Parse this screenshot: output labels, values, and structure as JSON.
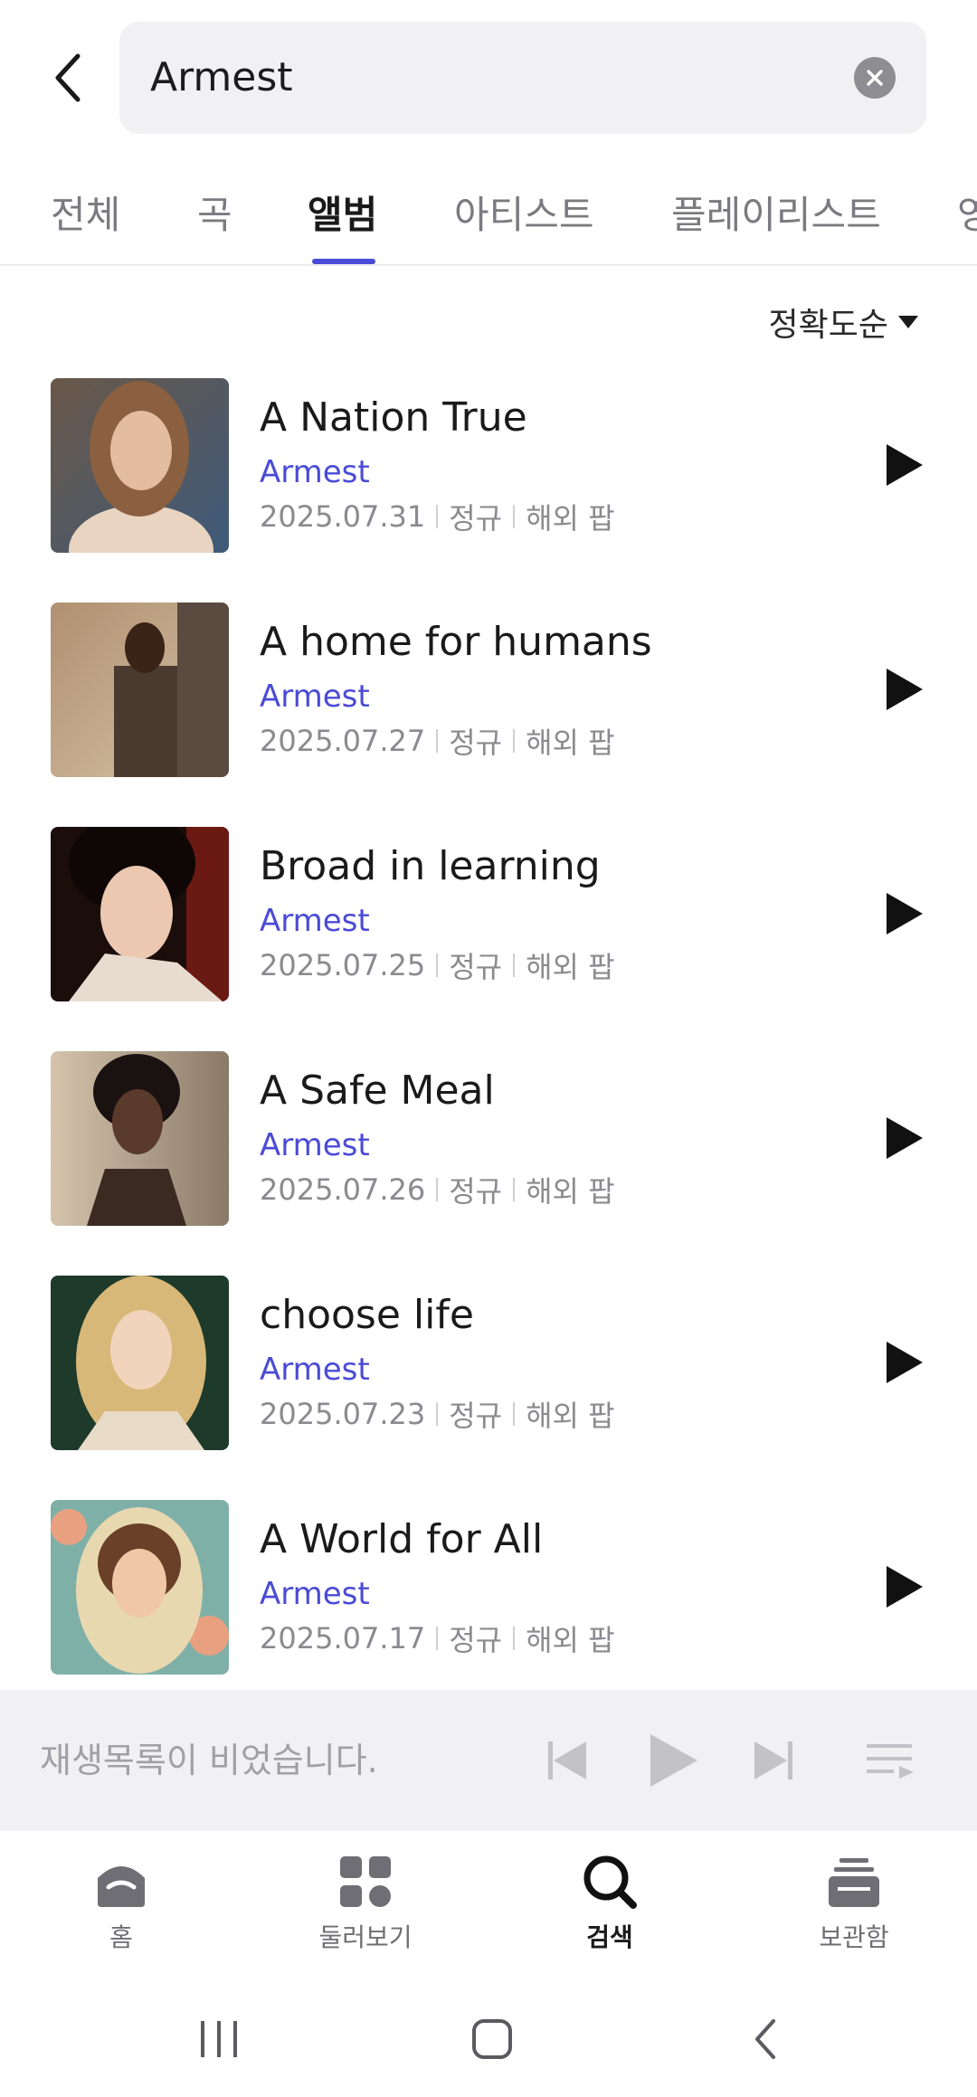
{
  "search": {
    "query": "Armest"
  },
  "tabs": [
    {
      "label": "전체"
    },
    {
      "label": "곡"
    },
    {
      "label": "앨범"
    },
    {
      "label": "아티스트"
    },
    {
      "label": "플레이리스트"
    },
    {
      "label": "영"
    }
  ],
  "active_tab": "앨범",
  "sort": {
    "label": "정확도순"
  },
  "albums": [
    {
      "title": "A Nation True",
      "artist": "Armest",
      "date": "2025.07.31",
      "type": "정규",
      "genre": "해외 팝",
      "cover_colors": [
        "#8a6a52",
        "#c99f7a",
        "#3e5a7a"
      ]
    },
    {
      "title": "A home for humans",
      "artist": "Armest",
      "date": "2025.07.27",
      "type": "정규",
      "genre": "해외 팝",
      "cover_colors": [
        "#b89a7a",
        "#4a3a30",
        "#d6c3a8"
      ]
    },
    {
      "title": "Broad in learning",
      "artist": "Armest",
      "date": "2025.07.25",
      "type": "정규",
      "genre": "해외 팝",
      "cover_colors": [
        "#5a1a12",
        "#e8c8b0",
        "#1a0d0a"
      ]
    },
    {
      "title": "A Safe Meal",
      "artist": "Armest",
      "date": "2025.07.26",
      "type": "정규",
      "genre": "해외 팝",
      "cover_colors": [
        "#c9b8a0",
        "#3a2a22",
        "#8a7a68"
      ]
    },
    {
      "title": "choose life",
      "artist": "Armest",
      "date": "2025.07.23",
      "type": "정규",
      "genre": "해외 팝",
      "cover_colors": [
        "#1e3a2a",
        "#e6cfa0",
        "#f0dcc0"
      ]
    },
    {
      "title": "A World for All",
      "artist": "Armest",
      "date": "2025.07.17",
      "type": "정규",
      "genre": "해외 팝",
      "cover_colors": [
        "#7fb0a8",
        "#e8a080",
        "#5a3a28"
      ]
    }
  ],
  "mini_player": {
    "empty_text": "재생목록이 비었습니다."
  },
  "bottom_nav": [
    {
      "label": "홈",
      "icon": "home-icon"
    },
    {
      "label": "둘러보기",
      "icon": "browse-icon"
    },
    {
      "label": "검색",
      "icon": "search-icon"
    },
    {
      "label": "보관함",
      "icon": "library-icon"
    }
  ],
  "colors": {
    "accent": "#4a4bd6",
    "text_primary": "#1a1a1a",
    "text_secondary": "#8a8a90",
    "player_bg": "#f1f1f3"
  }
}
